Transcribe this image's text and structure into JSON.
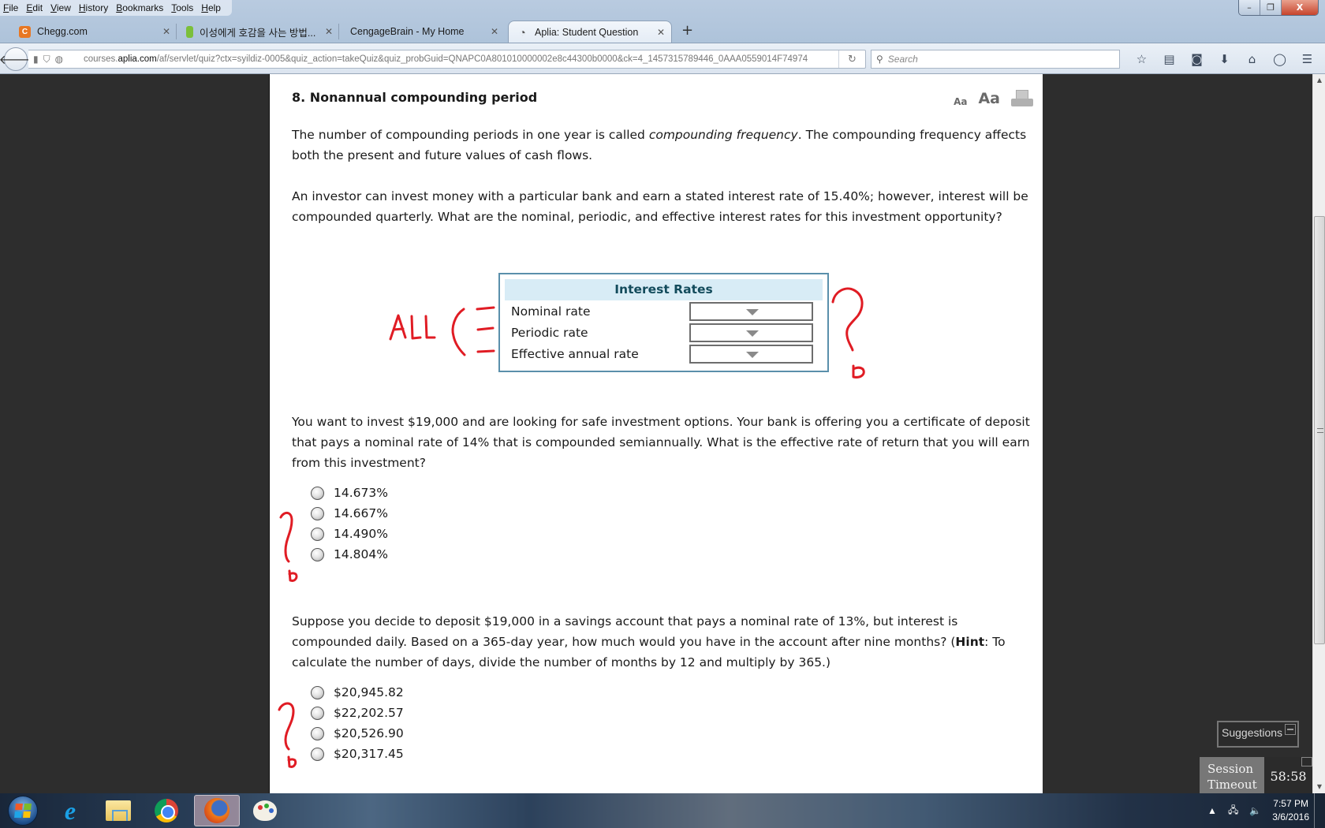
{
  "menubar": [
    "File",
    "Edit",
    "View",
    "History",
    "Bookmarks",
    "Tools",
    "Help"
  ],
  "window_controls": {
    "minimize": "–",
    "restore": "❐",
    "close": "X"
  },
  "tabs": [
    {
      "title": "Chegg.com",
      "favicon": "C",
      "color": "#e87722"
    },
    {
      "title": "이성에게 호감을 사는 방법...",
      "favicon": "▮",
      "color": "#7bbf3a"
    },
    {
      "title": "CengageBrain - My Home",
      "favicon": "",
      "color": ""
    },
    {
      "title": "Aplia: Student Question",
      "favicon": "◔",
      "color": "#555",
      "active": true
    }
  ],
  "new_tab": "+",
  "url": {
    "host_pre": "courses.",
    "host_domain": "aplia.com",
    "path": "/af/servlet/quiz?ctx=syildiz-0005&quiz_action=takeQuiz&quiz_probGuid=QNAPC0A801010000002e8c44300b0000&ck=4_1457315789446_0AAA0559014F74974"
  },
  "search": {
    "placeholder": "Search"
  },
  "question": {
    "title": "8.  Nonannual compounding period",
    "font_small": "Aa",
    "font_large": "Aa",
    "intro_pre": "The number of compounding periods in one year is called ",
    "intro_em": "compounding frequency",
    "intro_post": ". The compounding frequency affects both the present and future values of cash flows.",
    "part1": "An investor can invest money with a particular bank and earn a stated interest rate of 15.40%; however, interest will be compounded quarterly. What are the nominal, periodic, and effective interest rates for this investment opportunity?",
    "rates_table": {
      "header": "Interest Rates",
      "rows": [
        {
          "label": "Nominal rate",
          "selected": ""
        },
        {
          "label": "Periodic rate",
          "selected": ""
        },
        {
          "label": "Effective annual rate",
          "selected": ""
        }
      ]
    },
    "part2": "You want to invest $19,000 and are looking for safe investment options. Your bank is offering you a certificate of deposit that pays a nominal rate of 14% that is compounded semiannually. What is the effective rate of return that you will earn from this investment?",
    "part2_options": [
      "14.673%",
      "14.667%",
      "14.490%",
      "14.804%"
    ],
    "part3_pre": "Suppose you decide to deposit $19,000 in a savings account that pays a nominal rate of 13%, but interest is compounded daily. Based on a 365-day year, how much would you have in the account after nine months? (",
    "part3_hint": "Hint",
    "part3_post": ": To calculate the number of days, divide the number of months by 12 and multiply by 365.)",
    "part3_options": [
      "$20,945.82",
      "$22,202.57",
      "$20,526.90",
      "$20,317.45"
    ]
  },
  "annotations": {
    "all_label": "ALL"
  },
  "widgets": {
    "suggestions": "Suggestions",
    "session_label": "Session Timeout",
    "session_time": "58:58"
  },
  "taskbar": {
    "time": "7:57 PM",
    "date": "3/6/2016"
  }
}
